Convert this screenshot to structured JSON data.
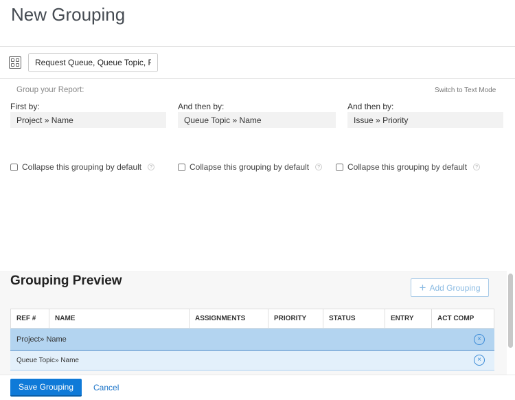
{
  "title": "New Grouping",
  "grouping_name": "Request Queue, Queue Topic, Priority",
  "group_label": "Group your Report:",
  "switch_mode": "Switch to Text Mode",
  "groups": [
    {
      "label": "First by:",
      "object": "Project",
      "field": "Name",
      "collapse": "Collapse this grouping by default",
      "collapsed": false
    },
    {
      "label": "And then by:",
      "object": "Queue Topic",
      "field": "Name",
      "collapse": "Collapse this grouping by default",
      "collapsed": false
    },
    {
      "label": "And then by:",
      "object": "Issue",
      "field": "Priority",
      "collapse": "Collapse this grouping by default",
      "collapsed": false
    }
  ],
  "preview": {
    "title": "Grouping Preview",
    "add_label": "Add Grouping",
    "columns": [
      "REF #",
      "NAME",
      "ASSIGNMENTS",
      "PRIORITY",
      "STATUS",
      "ENTRY",
      "ACT COMP"
    ],
    "rows": [
      {
        "object": "Project",
        "field": "Name",
        "color": "#b3d4f0"
      },
      {
        "object": "Queue Topic",
        "field": "Name",
        "color": "#e3f0fb"
      }
    ]
  },
  "separator": "»",
  "help": "?",
  "remove": "×",
  "plus": "+",
  "footer": {
    "save": "Save Grouping",
    "cancel": "Cancel"
  },
  "accent": "#0f7ad8"
}
